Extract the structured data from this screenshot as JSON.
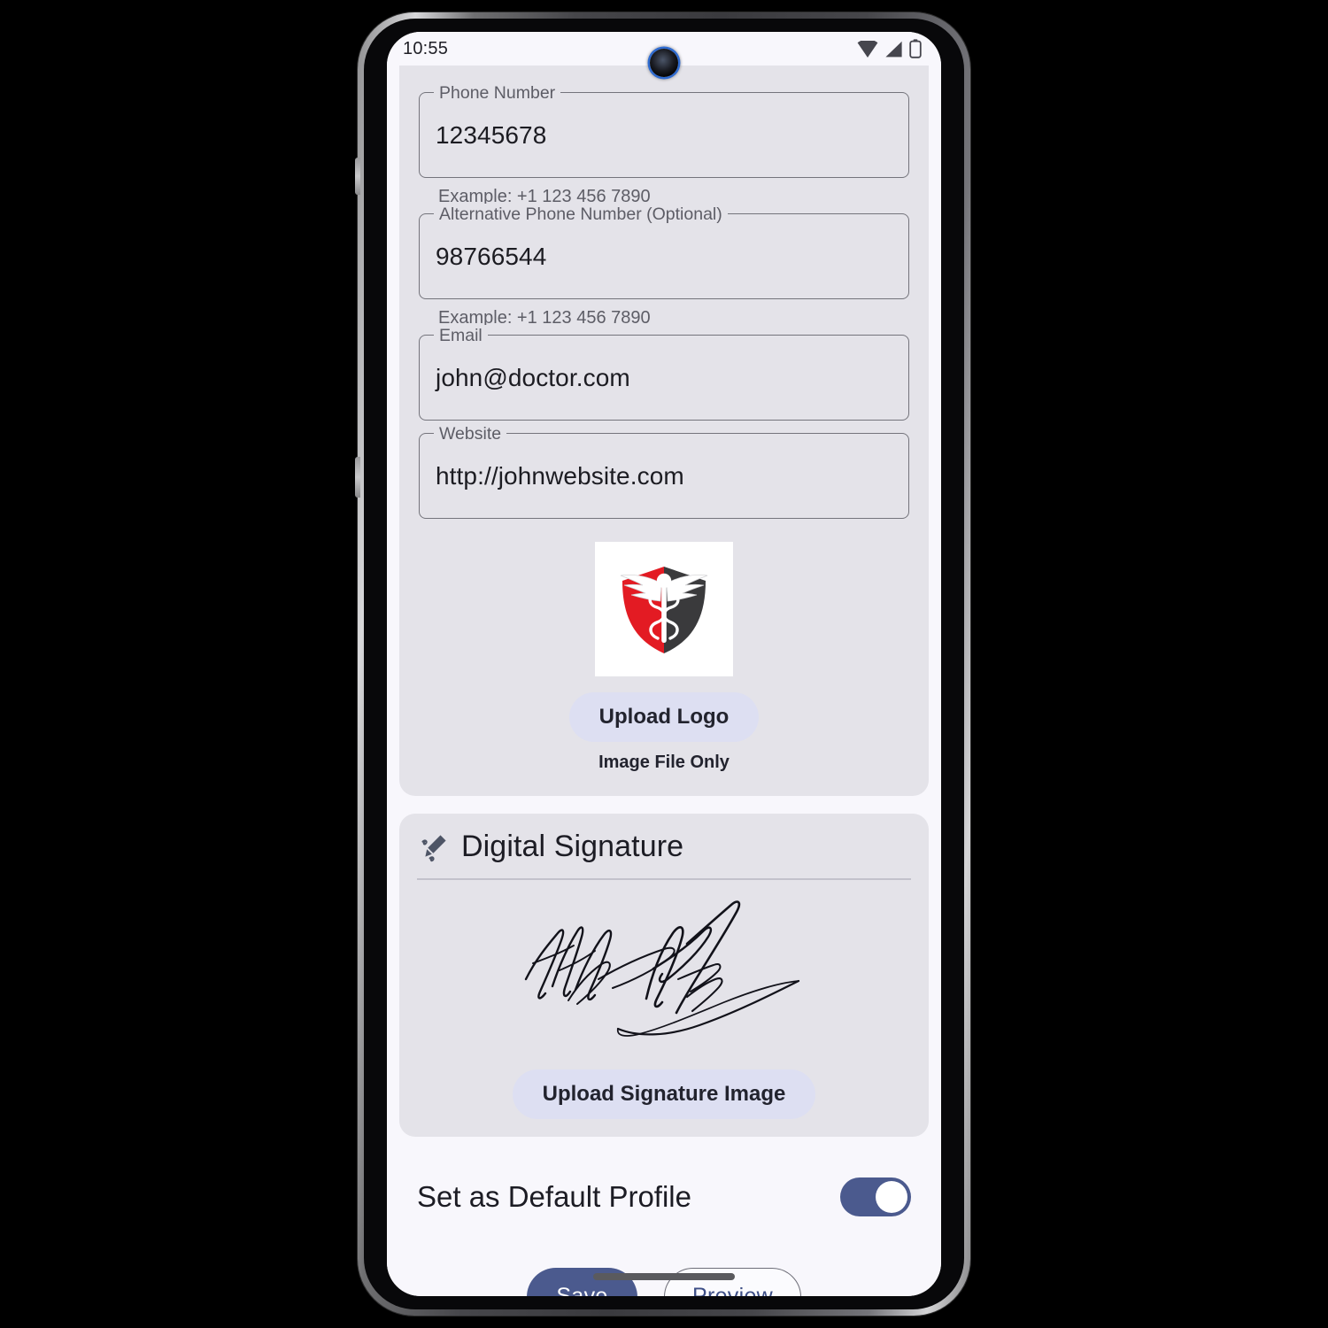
{
  "status_bar": {
    "time": "10:55",
    "icons": [
      "wifi-icon",
      "cellular-signal-icon",
      "battery-icon"
    ]
  },
  "contact_section": {
    "fields": [
      {
        "label": "Phone Number",
        "value": "12345678",
        "helper": "Example: +1 123 456 7890"
      },
      {
        "label": "Alternative Phone Number (Optional)",
        "value": "98766544",
        "helper": "Example: +1 123 456 7890"
      },
      {
        "label": "Email",
        "value": "john@doctor.com",
        "helper": ""
      },
      {
        "label": "Website",
        "value": "http://johnwebsite.com",
        "helper": ""
      }
    ],
    "logo": {
      "icon_name": "caduceus-shield-logo",
      "colors": {
        "shield_left": "#e31b23",
        "shield_right": "#3a3a3c",
        "staff": "#ffffff",
        "background": "#ffffff"
      },
      "upload_button_label": "Upload Logo",
      "note": "Image File Only"
    }
  },
  "signature_section": {
    "icon_name": "signature-pen-icon",
    "title": "Digital Signature",
    "signature_image_name": "handwritten-signature",
    "upload_button_label": "Upload Signature Image"
  },
  "default_profile": {
    "label": "Set as Default Profile",
    "enabled": true
  },
  "footer": {
    "save_label": "Save",
    "preview_label": "Preview"
  },
  "theme": {
    "page_background": "#f8f7fc",
    "card_background": "#e4e3e9",
    "accent": "#4b5a8e",
    "pill_button_background": "#dddff2",
    "field_border": "#74747c",
    "text_primary": "#1c1c24",
    "text_secondary": "#5d5d66"
  }
}
